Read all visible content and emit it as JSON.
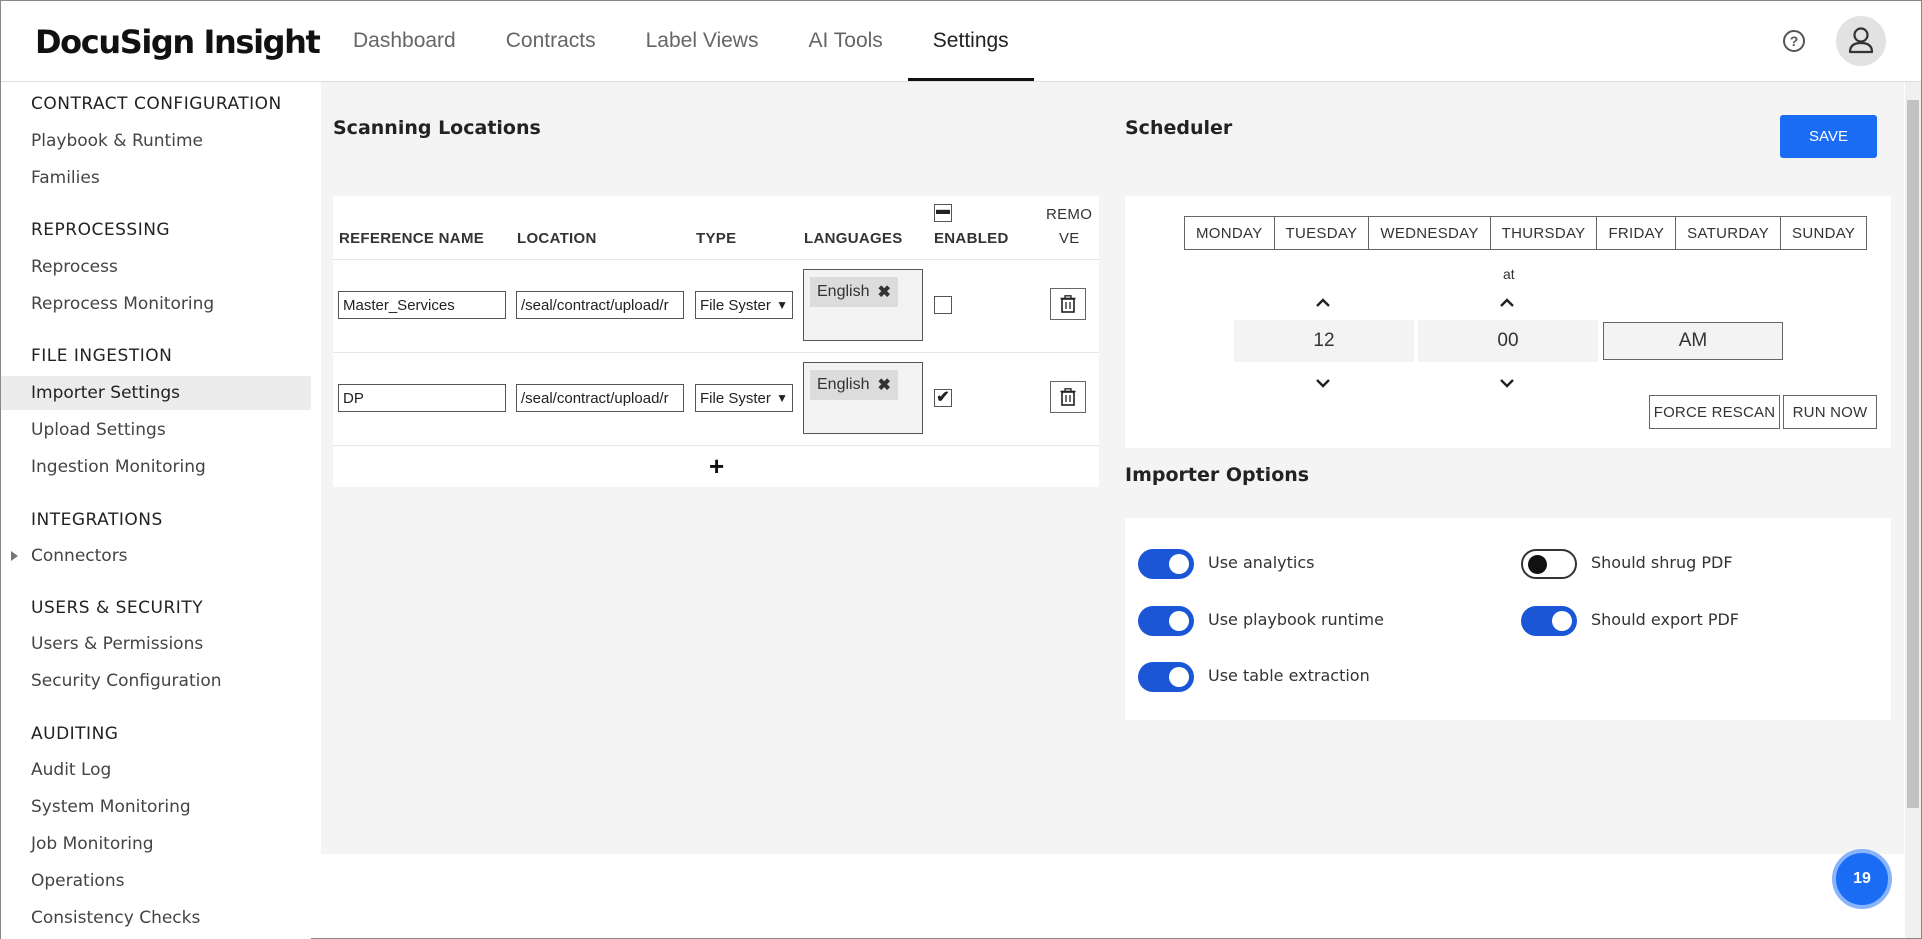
{
  "header": {
    "logo": "DocuSign Insight",
    "tabs": [
      {
        "label": "Dashboard"
      },
      {
        "label": "Contracts"
      },
      {
        "label": "Label Views"
      },
      {
        "label": "AI Tools"
      },
      {
        "label": "Settings",
        "active": true
      }
    ],
    "help_glyph": "?"
  },
  "sidebar": {
    "sections": [
      {
        "title": "CONTRACT CONFIGURATION",
        "items": [
          "Playbook & Runtime",
          "Families"
        ]
      },
      {
        "title": "REPROCESSING",
        "items": [
          "Reprocess",
          "Reprocess Monitoring"
        ]
      },
      {
        "title": "FILE INGESTION",
        "items": [
          "Importer Settings",
          "Upload Settings",
          "Ingestion Monitoring"
        ]
      },
      {
        "title": "INTEGRATIONS",
        "items": [
          "Connectors"
        ]
      },
      {
        "title": "USERS & SECURITY",
        "items": [
          "Users & Permissions",
          "Security Configuration"
        ]
      },
      {
        "title": "AUDITING",
        "items": [
          "Audit Log",
          "System Monitoring",
          "Job Monitoring",
          "Operations",
          "Consistency Checks"
        ]
      }
    ],
    "active_item": "Importer Settings"
  },
  "scanning": {
    "title": "Scanning Locations",
    "columns": {
      "reference": "REFERENCE NAME",
      "location": "LOCATION",
      "type": "TYPE",
      "languages": "LANGUAGES",
      "enabled": "ENABLED",
      "remove_1": "REMO",
      "remove_2": "VE"
    },
    "rows": [
      {
        "reference": "Master_Services",
        "location": "/seal/contract/upload/r",
        "type": "File Syster",
        "language": "English",
        "enabled": false
      },
      {
        "reference": "DP",
        "location": "/seal/contract/upload/r",
        "type": "File Syster",
        "language": "English",
        "enabled": true
      }
    ],
    "add_glyph": "+"
  },
  "scheduler": {
    "title": "Scheduler",
    "save_label": "SAVE",
    "days": [
      "MONDAY",
      "TUESDAY",
      "WEDNESDAY",
      "THURSDAY",
      "FRIDAY",
      "SATURDAY",
      "SUNDAY"
    ],
    "at_label": "at",
    "hour": "12",
    "minute": "00",
    "ampm": "AM",
    "force_rescan_label": "FORCE RESCAN",
    "run_now_label": "RUN NOW"
  },
  "importer": {
    "title": "Importer Options",
    "options": [
      {
        "label": "Use analytics",
        "on": true
      },
      {
        "label": "Use playbook runtime",
        "on": true
      },
      {
        "label": "Use table extraction",
        "on": true
      },
      {
        "label": "Should shrug PDF",
        "on": false
      },
      {
        "label": "Should export PDF",
        "on": true
      }
    ]
  },
  "notification_count": "19",
  "colors": {
    "accent": "#1a6cf5",
    "toggle_on": "#1a56d6",
    "panel_bg": "#f4f4f4"
  }
}
